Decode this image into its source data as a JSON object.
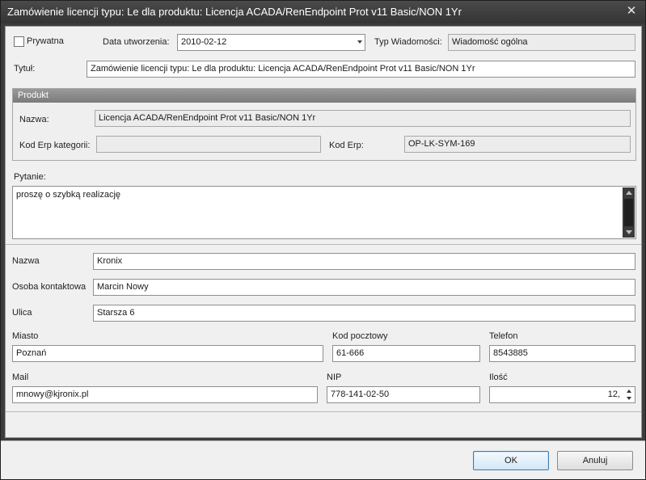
{
  "window": {
    "title": "Zamówienie licencji typu: Le dla produktu: Licencja ACADA/RenEndpoint Prot v11 Basic/NON 1Yr",
    "close_glyph": "✕"
  },
  "header": {
    "private_label": "Prywatna",
    "private_checked": false,
    "created_label": "Data utworzenia:",
    "created_value": "2010-02-12",
    "msg_type_label": "Typ Wiadomości:",
    "msg_type_value": "Wiadomość ogólna",
    "title_label": "Tytuł:",
    "title_value": "Zamówienie licencji typu: Le dla produktu: Licencja ACADA/RenEndpoint Prot v11 Basic/NON 1Yr"
  },
  "product": {
    "group_label": "Produkt",
    "name_label": "Nazwa:",
    "name_value": "Licencja ACADA/RenEndpoint Prot v11 Basic/NON 1Yr",
    "erp_cat_label": "Kod Erp kategorii:",
    "erp_cat_value": "",
    "erp_label": "Kod Erp:",
    "erp_value": "OP-LK-SYM-169"
  },
  "question": {
    "label": "Pytanie:",
    "value": "proszę o szybką realizację"
  },
  "contact": {
    "name_label": "Nazwa",
    "name_value": "Kronix",
    "person_label": "Osoba kontaktowa",
    "person_value": "Marcin Nowy",
    "street_label": "Ulica",
    "street_value": "Starsza 6",
    "city_label": "Miasto",
    "city_value": "Poznań",
    "zip_label": "Kod pocztowy",
    "zip_value": "61-666",
    "phone_label": "Telefon",
    "phone_value": "8543885",
    "mail_label": "Mail",
    "mail_value": "mnowy@kjronix.pl",
    "nip_label": "NIP",
    "nip_value": "778-141-02-50",
    "qty_label": "Ilość",
    "qty_value": "12,"
  },
  "buttons": {
    "ok_label": "OK",
    "cancel_label": "Anuluj"
  },
  "colors": {
    "titlebar": "#3a3a3a",
    "client_bg": "#f0f0f0",
    "group_header": "#8a8a8a",
    "default_button_border": "#3c7fb1"
  }
}
